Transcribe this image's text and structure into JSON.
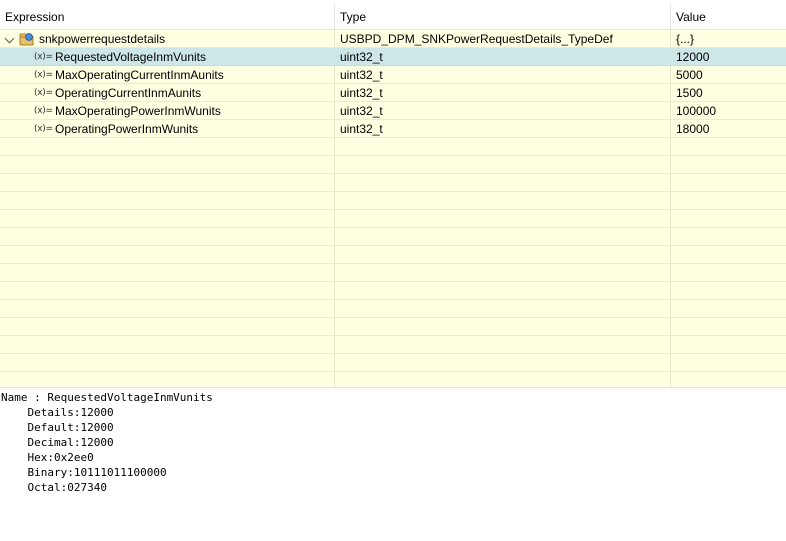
{
  "header": {
    "expression": "Expression",
    "type": "Type",
    "value": "Value"
  },
  "parent": {
    "name": "snkpowerrequestdetails",
    "type": "USBPD_DPM_SNKPowerRequestDetails_TypeDef",
    "value": "{...}",
    "expanded": true,
    "icon": "struct-icon"
  },
  "children": [
    {
      "icon_text": "(x)=",
      "name": "RequestedVoltageInmVunits",
      "type": "uint32_t",
      "value": "12000",
      "selected": true
    },
    {
      "icon_text": "(x)=",
      "name": "MaxOperatingCurrentInmAunits",
      "type": "uint32_t",
      "value": "5000",
      "selected": false
    },
    {
      "icon_text": "(x)=",
      "name": "OperatingCurrentInmAunits",
      "type": "uint32_t",
      "value": "1500",
      "selected": false
    },
    {
      "icon_text": "(x)=",
      "name": "MaxOperatingPowerInmWunits",
      "type": "uint32_t",
      "value": "100000",
      "selected": false
    },
    {
      "icon_text": "(x)=",
      "name": "OperatingPowerInmWunits",
      "type": "uint32_t",
      "value": "18000",
      "selected": false
    }
  ],
  "details": {
    "name_line": "Name : RequestedVoltageInmVunits",
    "lines": [
      "    Details:12000",
      "    Default:12000",
      "    Decimal:12000",
      "    Hex:0x2ee0",
      "    Binary:10111011100000",
      "    Octal:027340"
    ]
  },
  "colors": {
    "table_bg": "#ffffe2",
    "selected_row": "#cde6e8"
  }
}
